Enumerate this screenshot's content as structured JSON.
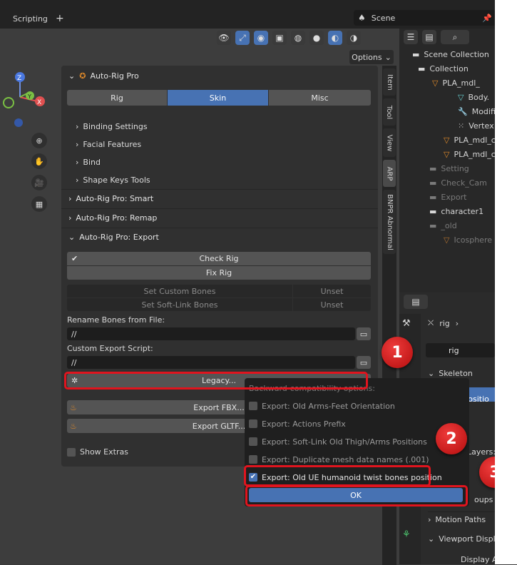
{
  "topbar": {
    "workspace_tab": "Scripting",
    "add_tab": "+",
    "scene_name": "Scene"
  },
  "viewport": {
    "options_label": "Options"
  },
  "panel": {
    "title": "Auto-Rig Pro",
    "tabs": [
      "Rig",
      "Skin",
      "Misc"
    ],
    "active_tab": "Skin",
    "sections": [
      "Binding Settings",
      "Facial Features",
      "Bind",
      "Shape Keys Tools"
    ],
    "smart": "Auto-Rig Pro: Smart",
    "remap": "Auto-Rig Pro: Remap",
    "export": "Auto-Rig Pro: Export",
    "check_rig": "Check Rig",
    "fix_rig": "Fix Rig",
    "set_custom_bones": "Set Custom Bones",
    "set_softlink_bones": "Set Soft-Link Bones",
    "unset": "Unset",
    "rename_label": "Rename Bones from File:",
    "rename_value": "//",
    "script_label": "Custom Export Script:",
    "script_value": "//",
    "legacy": "Legacy...",
    "export_fbx": "Export FBX...",
    "export_gltf": "Export GLTF...",
    "show_extras": "Show Extras"
  },
  "side_tabs": [
    "Item",
    "Tool",
    "View",
    "ARP",
    "BNPR Abnormal"
  ],
  "outliner": {
    "rows": [
      {
        "label": "Scene Collection"
      },
      {
        "label": "Collection"
      },
      {
        "label": "PLA_mdl_"
      },
      {
        "label": "Body."
      },
      {
        "label": "Modifi"
      },
      {
        "label": "Vertex"
      },
      {
        "label": "PLA_mdl_c"
      },
      {
        "label": "PLA_mdl_c"
      },
      {
        "label": "Setting"
      },
      {
        "label": "Check_Cam"
      },
      {
        "label": "Export"
      },
      {
        "label": "character1"
      },
      {
        "label": "_old"
      },
      {
        "label": "Icosphere"
      }
    ]
  },
  "properties": {
    "breadcrumb": "rig",
    "object_field": "rig",
    "skeleton": "Skeleton",
    "pose_position": "e Positio",
    "layers": "Layers:",
    "groups": "oups",
    "motion_paths": "Motion Paths",
    "viewport_display": "Viewport Displa",
    "display_as": "Display A"
  },
  "popup": {
    "title": "Backward-compatibility options:",
    "options": [
      {
        "label": "Export: Old Arms-Feet Orientation",
        "checked": false
      },
      {
        "label": "Export: Actions Prefix",
        "checked": false
      },
      {
        "label": "Export: Soft-Link Old Thigh/Arms Positions",
        "checked": false
      },
      {
        "label": "Export: Duplicate mesh data names (.001)",
        "checked": false
      },
      {
        "label": "Export: Old UE humanoid twist bones position",
        "checked": true
      }
    ],
    "ok": "OK"
  },
  "markers": [
    "1",
    "2",
    "3"
  ],
  "colors": {
    "accent": "#4772b3",
    "annotation": "#e0141e"
  }
}
